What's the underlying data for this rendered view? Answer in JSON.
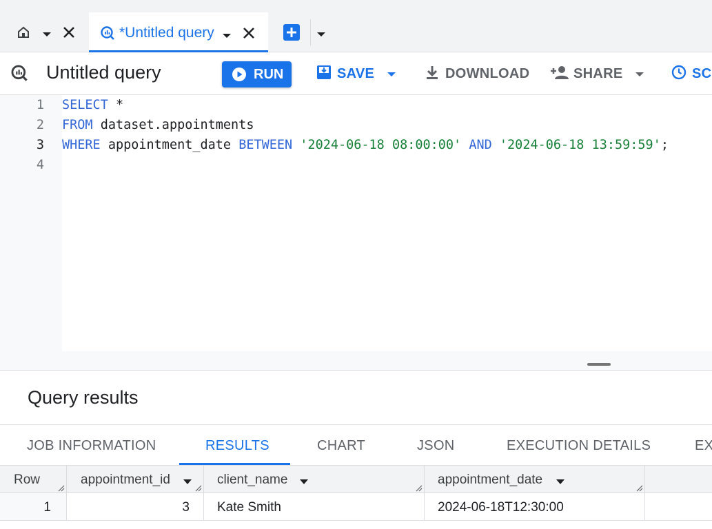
{
  "tabs": {
    "active_title": "*Untitled query"
  },
  "toolbar": {
    "title": "Untitled query",
    "run_label": "RUN",
    "save_label": "SAVE",
    "download_label": "DOWNLOAD",
    "share_label": "SHARE",
    "schedule_label": "SCH"
  },
  "editor": {
    "lines": [
      {
        "num": "1",
        "tokens": [
          {
            "t": "SELECT",
            "c": "kw"
          },
          {
            "t": " *",
            "c": "id"
          }
        ]
      },
      {
        "num": "2",
        "tokens": [
          {
            "t": "FROM",
            "c": "kw"
          },
          {
            "t": " dataset.appointments",
            "c": "id"
          }
        ]
      },
      {
        "num": "3",
        "tokens": [
          {
            "t": "WHERE",
            "c": "kw"
          },
          {
            "t": " appointment_date ",
            "c": "id"
          },
          {
            "t": "BETWEEN",
            "c": "kw"
          },
          {
            "t": " ",
            "c": "id"
          },
          {
            "t": "'2024-06-18 08:00:00'",
            "c": "str"
          },
          {
            "t": " ",
            "c": "id"
          },
          {
            "t": "AND",
            "c": "kw"
          },
          {
            "t": " ",
            "c": "id"
          },
          {
            "t": "'2024-06-18 13:59:59'",
            "c": "str"
          },
          {
            "t": ";",
            "c": "id"
          }
        ]
      },
      {
        "num": "4",
        "tokens": []
      }
    ]
  },
  "results": {
    "title": "Query results",
    "tabs": [
      "JOB INFORMATION",
      "RESULTS",
      "CHART",
      "JSON",
      "EXECUTION DETAILS",
      "EX"
    ],
    "columns": [
      "Row",
      "appointment_id",
      "client_name",
      "appointment_date"
    ],
    "rows": [
      [
        "1",
        "3",
        "Kate Smith",
        "2024-06-18T12:30:00"
      ]
    ]
  },
  "colors": {
    "accent": "#1a73e8",
    "keyword": "#3367d6",
    "string": "#188038"
  }
}
